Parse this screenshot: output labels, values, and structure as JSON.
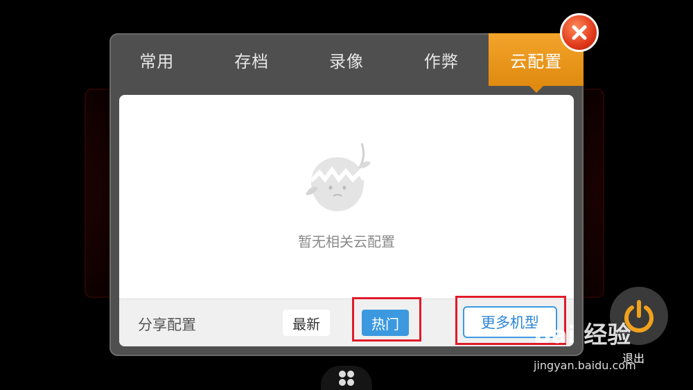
{
  "tabs": [
    {
      "label": "常用"
    },
    {
      "label": "存档"
    },
    {
      "label": "录像"
    },
    {
      "label": "作弊"
    },
    {
      "label": "云配置",
      "active": true
    }
  ],
  "empty_state": {
    "text": "暂无相关云配置",
    "icon": "broken-egg-icon"
  },
  "bottom_bar": {
    "share_label": "分享配置",
    "newest_label": "最新",
    "hot_label": "热门",
    "more_models_label": "更多机型"
  },
  "overlay": {
    "exit_label": "退出",
    "close_icon": "close-icon",
    "power_icon": "power-icon",
    "menu_icon": "grid-menu-icon"
  },
  "watermark": {
    "logo": "Bai 经验",
    "url": "jingyan.baidu.com"
  },
  "colors": {
    "accent_orange": "#e8951a",
    "accent_blue": "#3c99e0",
    "highlight_red": "#e01a2a"
  }
}
